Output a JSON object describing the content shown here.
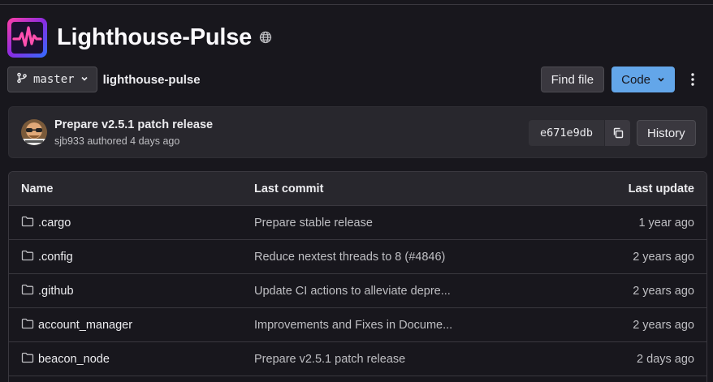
{
  "project": {
    "title": "Lighthouse-Pulse",
    "avatar_icon": "pulse-waveform-icon",
    "visibility_icon": "globe-icon",
    "accent_gradient": [
      "#ff3fa4",
      "#8a2be2",
      "#2f6fff"
    ]
  },
  "toolbar": {
    "branch_icon": "branch-icon",
    "branch": "master",
    "breadcrumb": "lighthouse-pulse",
    "find_file_label": "Find file",
    "code_label": "Code",
    "more_icon": "kebab-icon"
  },
  "last_commit": {
    "title": "Prepare v2.5.1 patch release",
    "author": "sjb933",
    "authored_text": "authored",
    "time": "4 days ago",
    "sha": "e671e9db",
    "copy_icon": "copy-icon",
    "history_label": "History"
  },
  "table": {
    "headers": {
      "name": "Name",
      "last_commit": "Last commit",
      "last_update": "Last update"
    },
    "rows": [
      {
        "name": ".cargo",
        "commit": "Prepare stable release",
        "updated": "1 year ago"
      },
      {
        "name": ".config",
        "commit": "Reduce nextest threads to 8 (#4846)",
        "updated": "2 years ago"
      },
      {
        "name": ".github",
        "commit": "Update CI actions to alleviate depre...",
        "updated": "2 years ago"
      },
      {
        "name": "account_manager",
        "commit": "Improvements and Fixes in Docume...",
        "updated": "2 years ago"
      },
      {
        "name": "beacon_node",
        "commit": "Prepare v2.5.1 patch release",
        "updated": "2 days ago"
      }
    ]
  },
  "colors": {
    "background": "#18171d",
    "panel": "#28272d",
    "confirm_button": "#63a6e9",
    "border": "#3a383f"
  }
}
